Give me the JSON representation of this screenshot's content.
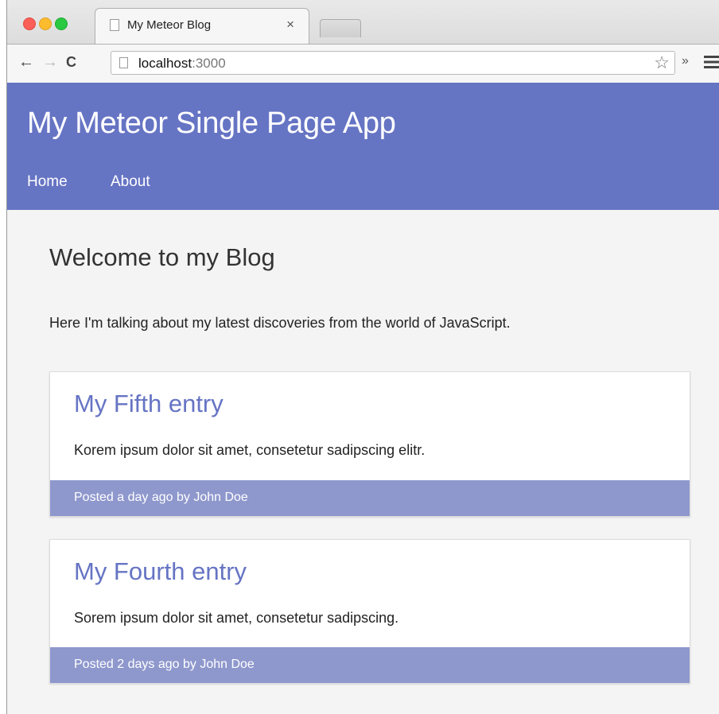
{
  "browser": {
    "tab_title": "My Meteor Blog",
    "tab_close": "×",
    "url_host": "localhost",
    "url_port": ":3000",
    "back": "←",
    "forward": "→",
    "reload": "C",
    "bookmark_star": "☆",
    "extensions_more": "»"
  },
  "header": {
    "title": "My Meteor Single Page App",
    "nav": [
      "Home",
      "About"
    ],
    "bg_color": "#6674c4"
  },
  "main": {
    "heading": "Welcome to my Blog",
    "intro": "Here I'm talking about my latest discoveries from the world of JavaScript.",
    "posts": [
      {
        "title": "My Fifth entry",
        "body": "Korem ipsum dolor sit amet, consetetur sadipscing elitr.",
        "footer": "Posted a day ago by John Doe"
      },
      {
        "title": "My Fourth entry",
        "body": "Sorem ipsum dolor sit amet, consetetur sadipscing.",
        "footer": "Posted 2 days ago by John Doe"
      }
    ],
    "footer_color": "#8e98cd"
  },
  "icons": {
    "page": "page-icon",
    "star": "star-icon",
    "menu": "menu-icon"
  }
}
